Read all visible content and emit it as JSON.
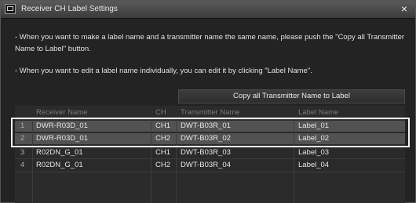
{
  "window": {
    "title": "Receiver CH Label Settings",
    "close_glyph": "×"
  },
  "instructions": [
    "- When you want to make a label name and a transmitter name the same name, please push the \"Copy all Transmitter Name to Label\" button.",
    "- When you want to edit a label name individually, you can edit it by clicking \"Label Name\"."
  ],
  "copy_button": {
    "label": "Copy all Transmitter Name to Label"
  },
  "table": {
    "columns": [
      "Receiver Name",
      "CH",
      "Transmitter Name",
      "Label Name"
    ],
    "rows": [
      {
        "index": "1",
        "receiver": "DWR-R03D_01",
        "ch": "CH1",
        "transmitter": "DWT-B03R_01",
        "label": "Label_01",
        "selected": true
      },
      {
        "index": "2",
        "receiver": "DWR-R03D_01",
        "ch": "CH2",
        "transmitter": "DWT-B03R_02",
        "label": "Label_02",
        "selected": true
      },
      {
        "index": "3",
        "receiver": "R02DN_G_01",
        "ch": "CH1",
        "transmitter": "DWT-B03R_03",
        "label": "Label_03",
        "selected": false
      },
      {
        "index": "4",
        "receiver": "R02DN_G_01",
        "ch": "CH2",
        "transmitter": "DWT-B03R_04",
        "label": "Label_04",
        "selected": false
      }
    ]
  },
  "colors": {
    "selected_row": "#525252",
    "highlight_border": "#f2f2f2"
  }
}
